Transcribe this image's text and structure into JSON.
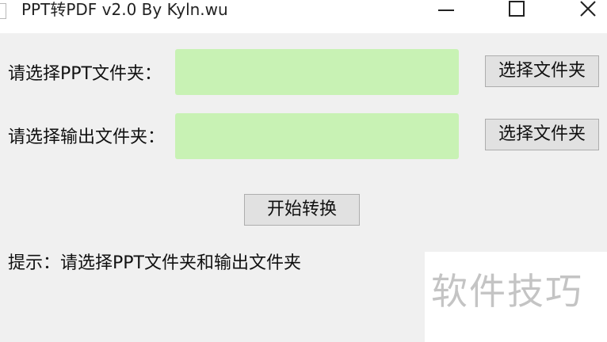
{
  "window": {
    "title": "PPT转PDF v2.0 By Kyln.wu",
    "icons": {
      "app": "document-icon",
      "minimize": "minimize-icon",
      "maximize": "maximize-icon",
      "close": "close-icon"
    }
  },
  "form": {
    "ppt_folder": {
      "label": "请选择PPT文件夹：",
      "value": "",
      "button_label": "选择文件夹"
    },
    "output_folder": {
      "label": "请选择输出文件夹：",
      "value": "",
      "button_label": "选择文件夹"
    },
    "start_button_label": "开始转换"
  },
  "status": {
    "hint": "提示：请选择PPT文件夹和输出文件夹"
  },
  "watermark": {
    "text": "软件技巧"
  },
  "colors": {
    "field_background": "#c8f2b4",
    "window_background": "#f0f0f0",
    "titlebar_background": "#ffffff",
    "button_background": "#e1e1e1"
  }
}
